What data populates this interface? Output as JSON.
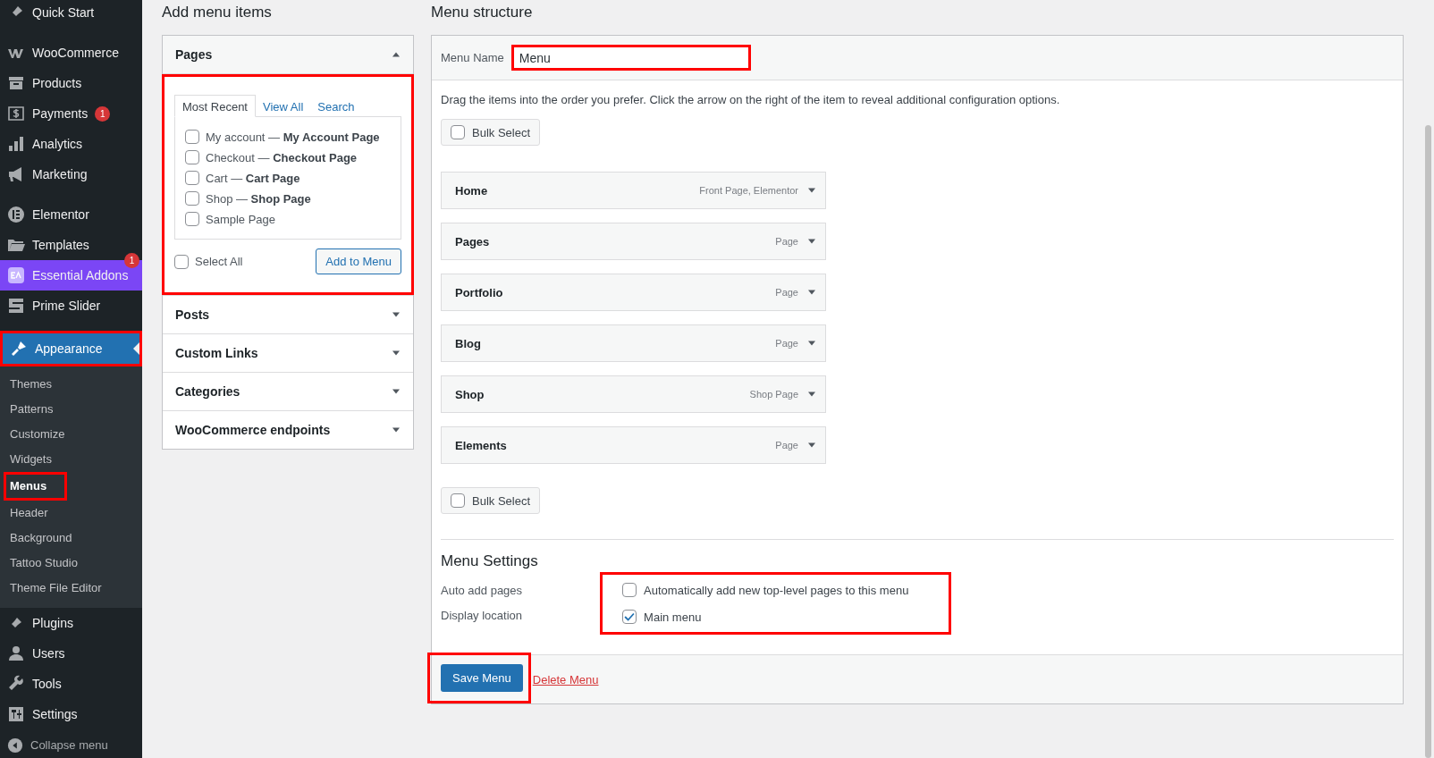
{
  "sidebar": {
    "groups": [
      [
        {
          "label": "Quick Start",
          "current": false,
          "highlighted": false
        }
      ],
      [
        {
          "label": "WooCommerce",
          "current": false,
          "highlighted": false
        },
        {
          "label": "Products",
          "current": false,
          "highlighted": false
        },
        {
          "label": "Payments",
          "current": false,
          "highlighted": false,
          "badge": "1"
        },
        {
          "label": "Analytics",
          "current": false,
          "highlighted": false
        },
        {
          "label": "Marketing",
          "current": false,
          "highlighted": false
        }
      ],
      [
        {
          "label": "Elementor",
          "current": false,
          "highlighted": false
        },
        {
          "label": "Templates",
          "current": false,
          "highlighted": false
        },
        {
          "label": "Essential Addons",
          "current": false,
          "highlighted": false,
          "badge": "1",
          "color": "#7b46f5"
        },
        {
          "label": "Prime Slider",
          "current": false,
          "highlighted": false
        }
      ],
      [
        {
          "label": "Appearance",
          "current": true,
          "highlighted": true,
          "children": [
            {
              "label": "Themes",
              "selected": false,
              "highlighted": false
            },
            {
              "label": "Patterns",
              "selected": false,
              "highlighted": false
            },
            {
              "label": "Customize",
              "selected": false,
              "highlighted": false
            },
            {
              "label": "Widgets",
              "selected": false,
              "highlighted": false
            },
            {
              "label": "Menus",
              "selected": true,
              "highlighted": true
            },
            {
              "label": "Header",
              "selected": false,
              "highlighted": false
            },
            {
              "label": "Background",
              "selected": false,
              "highlighted": false
            },
            {
              "label": "Tattoo Studio",
              "selected": false,
              "highlighted": false
            },
            {
              "label": "Theme File Editor",
              "selected": false,
              "highlighted": false
            }
          ]
        },
        {
          "label": "Plugins",
          "current": false,
          "highlighted": false
        },
        {
          "label": "Users",
          "current": false,
          "highlighted": false
        },
        {
          "label": "Tools",
          "current": false,
          "highlighted": false
        },
        {
          "label": "Settings",
          "current": false,
          "highlighted": false
        }
      ]
    ],
    "collapse": "Collapse menu"
  },
  "add_items": {
    "title": "Add menu items",
    "sections": [
      {
        "title": "Pages",
        "expanded": true,
        "highlighted": true,
        "tabs": [
          {
            "label": "Most Recent",
            "selected": true
          },
          {
            "label": "View All",
            "selected": false
          },
          {
            "label": "Search",
            "selected": false
          }
        ],
        "items": [
          {
            "label": "My account — **My Account Page**",
            "checked": false
          },
          {
            "label": "Checkout — **Checkout Page**",
            "checked": false
          },
          {
            "label": "Cart — **Cart Page**",
            "checked": false
          },
          {
            "label": "Shop — **Shop Page**",
            "checked": false
          },
          {
            "label": "Sample Page",
            "checked": false
          }
        ],
        "select_all": {
          "label": "Select All",
          "checked": false
        },
        "button": "Add to Menu"
      },
      {
        "title": "Posts",
        "expanded": false
      },
      {
        "title": "Custom Links",
        "expanded": false
      },
      {
        "title": "Categories",
        "expanded": false
      },
      {
        "title": "WooCommerce endpoints",
        "expanded": false
      }
    ]
  },
  "menu_structure": {
    "title": "Menu structure",
    "menu_name": {
      "label": "Menu Name",
      "value": "Menu",
      "highlighted": true
    },
    "instructions": "Drag the items into the order you prefer. Click the arrow on the right of the item to reveal additional configuration options.",
    "bulk_select_top": {
      "label": "Bulk Select",
      "checked": false
    },
    "items": [
      {
        "title": "Home",
        "type": "Front Page, Elementor"
      },
      {
        "title": "Pages",
        "type": "Page"
      },
      {
        "title": "Portfolio",
        "type": "Page"
      },
      {
        "title": "Blog",
        "type": "Page"
      },
      {
        "title": "Shop",
        "type": "Shop Page"
      },
      {
        "title": "Elements",
        "type": "Page"
      }
    ],
    "bulk_select_bottom": {
      "label": "Bulk Select",
      "checked": false
    },
    "settings": {
      "title": "Menu Settings",
      "highlighted": true,
      "rows": [
        {
          "label": "Auto add pages",
          "option": "Automatically add new top-level pages to this menu",
          "checked": false
        },
        {
          "label": "Display location",
          "option": "Main menu",
          "checked": true
        }
      ]
    },
    "save": {
      "label": "Save Menu",
      "highlighted": true
    },
    "delete": "Delete Menu"
  }
}
